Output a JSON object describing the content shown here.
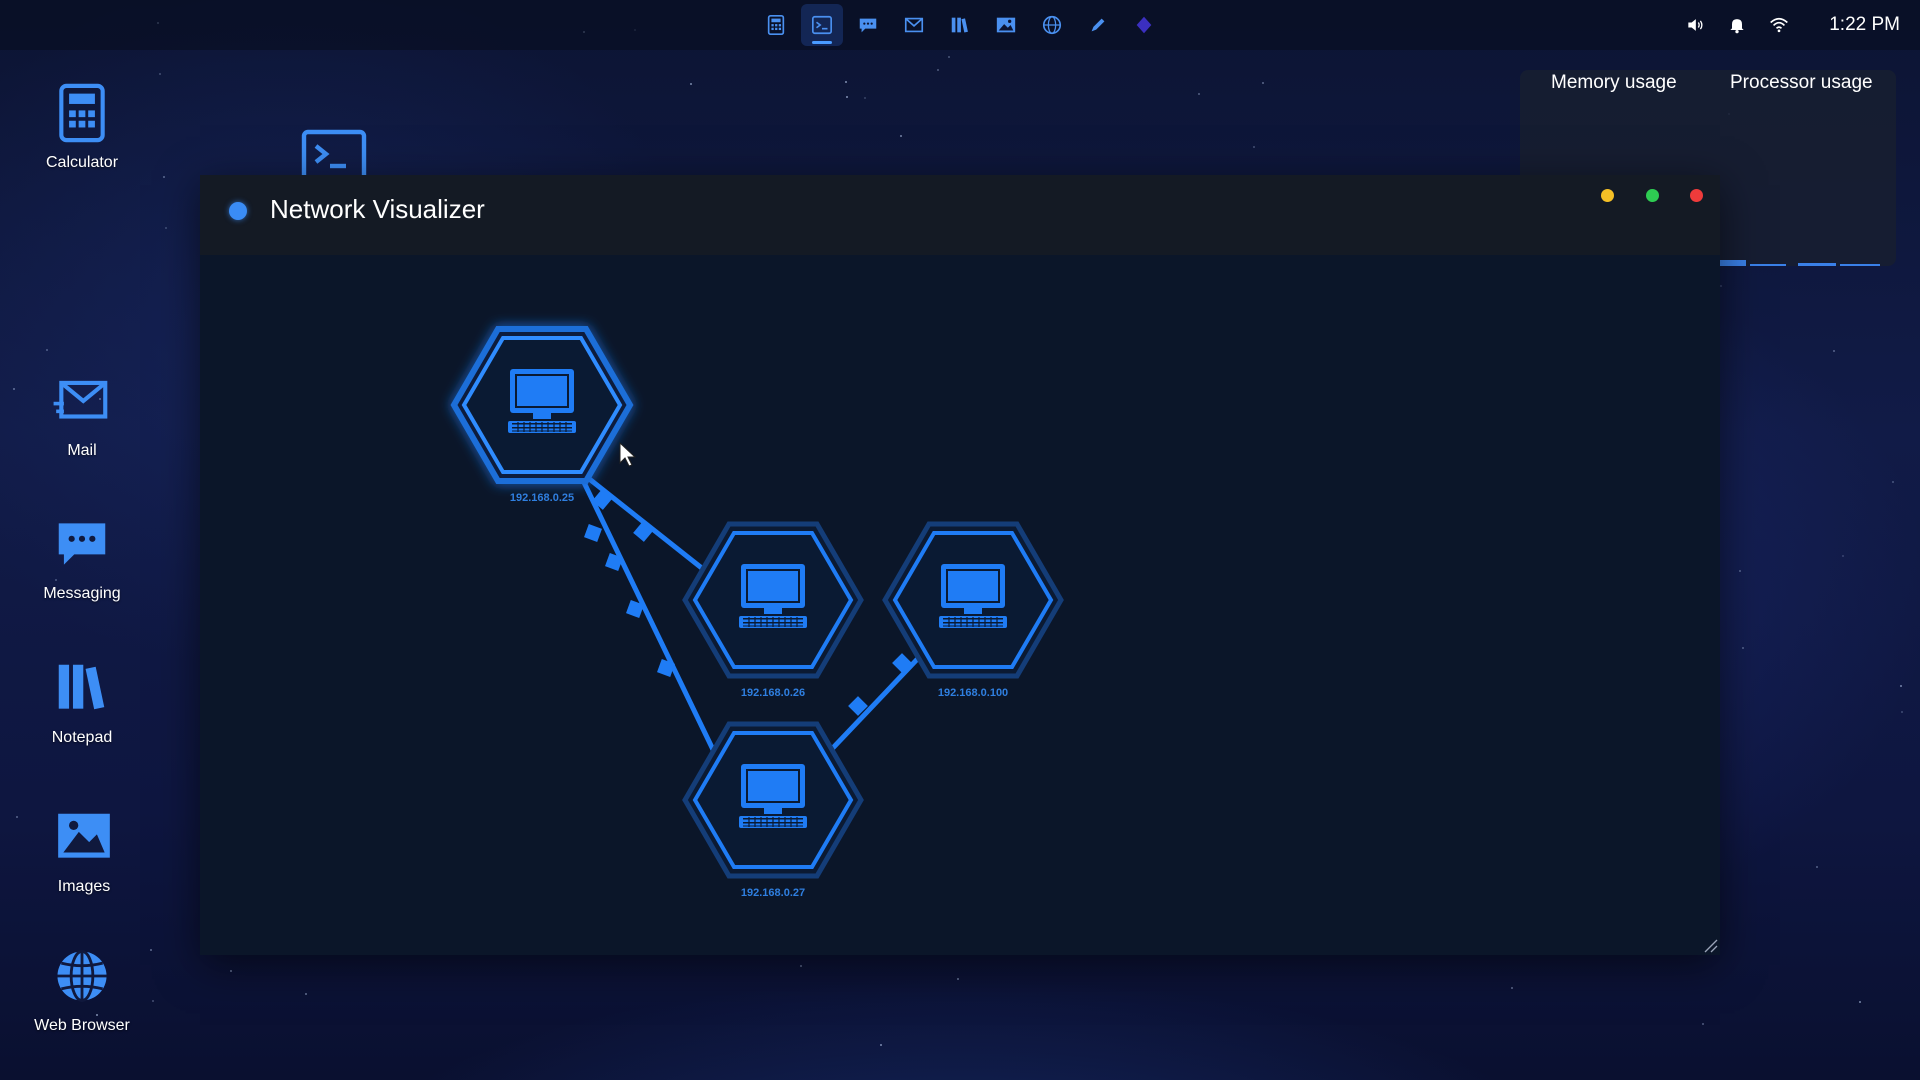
{
  "topbar": {
    "dock": [
      {
        "name": "calculator",
        "icon": "calculator-icon",
        "active": false
      },
      {
        "name": "terminal",
        "icon": "terminal-icon",
        "active": true
      },
      {
        "name": "messaging",
        "icon": "chat-icon",
        "active": false
      },
      {
        "name": "mail",
        "icon": "mail-icon",
        "active": false
      },
      {
        "name": "notepad",
        "icon": "books-icon",
        "active": false
      },
      {
        "name": "images",
        "icon": "image-icon",
        "active": false
      },
      {
        "name": "web-browser",
        "icon": "globe-icon",
        "active": false
      },
      {
        "name": "pen",
        "icon": "pen-icon",
        "active": false
      },
      {
        "name": "gem",
        "icon": "gem-icon",
        "active": false
      }
    ],
    "tray": {
      "volume_icon": "speaker-icon",
      "notification_icon": "bell-icon",
      "wifi_icon": "wifi-icon",
      "time": "1:22 PM"
    }
  },
  "desktop": {
    "icons": [
      {
        "label": "Calculator",
        "icon": "calculator-icon"
      },
      {
        "label": "Mail",
        "icon": "mail-icon"
      },
      {
        "label": "Messaging",
        "icon": "chat-icon"
      },
      {
        "label": "Notepad",
        "icon": "books-icon"
      },
      {
        "label": "Images",
        "icon": "image-icon"
      },
      {
        "label": "Web Browser",
        "icon": "globe-icon"
      }
    ]
  },
  "stats_widget": {
    "memory_label": "Memory usage",
    "processor_label": "Processor usage"
  },
  "window": {
    "title": "Network Visualizer",
    "controls": {
      "minimize": "#f5c026",
      "maximize": "#2ecc52",
      "close": "#ef3b3b"
    }
  },
  "network": {
    "nodes": [
      {
        "id": "n1",
        "label": "192.168.0.25",
        "selected": true
      },
      {
        "id": "n2",
        "label": "192.168.0.26",
        "selected": false
      },
      {
        "id": "n3",
        "label": "192.168.0.100",
        "selected": false
      },
      {
        "id": "n4",
        "label": "192.168.0.27",
        "selected": false
      }
    ],
    "links": [
      {
        "from": "n1",
        "to": "n2"
      },
      {
        "from": "n1",
        "to": "n4"
      },
      {
        "from": "n4",
        "to": "n3"
      }
    ]
  },
  "colors": {
    "accent": "#1f7cf5",
    "window_bg": "#0b1629",
    "titlebar_bg": "#141a24"
  }
}
